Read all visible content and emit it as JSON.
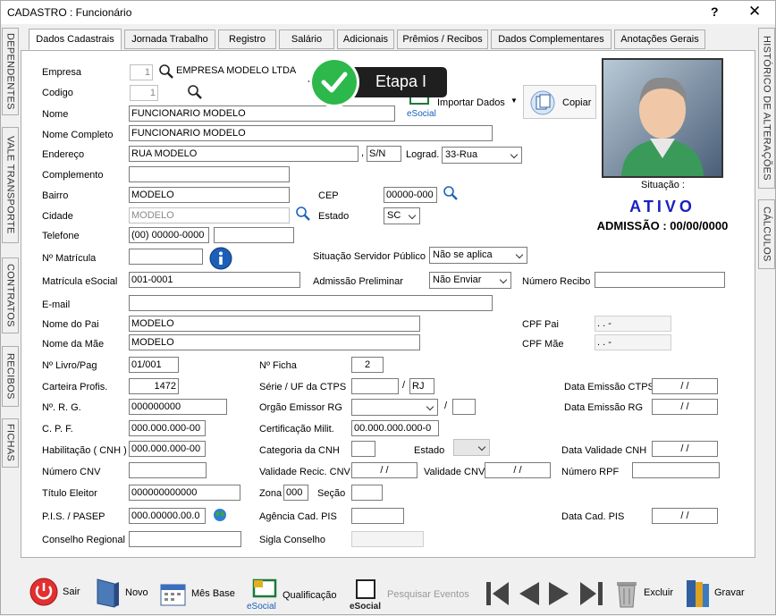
{
  "window": {
    "title": "CADASTRO : Funcionário",
    "help": "?",
    "close": "✕"
  },
  "side_tabs_left": [
    "DEPENDENTES",
    "VALE TRANSPORTE",
    "CONTRATOS",
    "RECIBOS",
    "FICHAS"
  ],
  "side_tabs_right": [
    "HISTÓRICO DE ALTERAÇÕES",
    "CÁLCULOS"
  ],
  "tabs": [
    "Dados Cadastrais",
    "Jornada Trabalho",
    "Registro",
    "Salário",
    "Adicionais",
    "Prêmios / Recibos",
    "Dados Complementares",
    "Anotações Gerais"
  ],
  "callout": {
    "label": "Etapa I"
  },
  "actions": {
    "importar": "Importar Dados",
    "esocial": "eSocial",
    "copiar": "Copiar"
  },
  "profile": {
    "situacao_label": "Situação :",
    "situacao": "ATIVO",
    "admissao": "ADMISSÃO : 00/00/0000"
  },
  "form": {
    "empresa_label": "Empresa",
    "empresa_code": "1",
    "empresa_name": "EMPRESA MODELO LTDA",
    "codigo_label": "Codigo",
    "codigo": "1",
    "nome_label": "Nome",
    "nome": "FUNCIONARIO MODELO",
    "nome_completo_label": "Nome Completo",
    "nome_completo": "FUNCIONARIO MODELO",
    "endereco_label": "Endereço",
    "endereco": "RUA MODELO",
    "numero": "S/N",
    "lograd_label": "Lograd.",
    "lograd": "33-Rua",
    "complemento_label": "Complemento",
    "complemento": "",
    "bairro_label": "Bairro",
    "bairro": "MODELO",
    "cep_label": "CEP",
    "cep": "00000-000",
    "cidade_label": "Cidade",
    "cidade": "MODELO",
    "estado_label": "Estado",
    "estado": "SC",
    "telefone_label": "Telefone",
    "telefone": "(00) 00000-0000",
    "telefone2": "",
    "matricula_label": "Nº  Matrícula",
    "matricula": "",
    "sit_servidor_label": "Situação Servidor Público",
    "sit_servidor": "Não se aplica",
    "matricula_esocial_label": "Matrícula eSocial",
    "matricula_esocial": "001-0001",
    "admissao_prelim_label": "Admissão Preliminar",
    "admissao_prelim": "Não Enviar",
    "numero_recibo_label": "Número Recibo",
    "numero_recibo": "",
    "email_label": "E-mail",
    "email": "",
    "pai_label": "Nome do Pai",
    "pai": "MODELO",
    "cpf_pai_label": "CPF Pai",
    "cpf_pai": " .   .   -",
    "mae_label": "Nome da Mãe",
    "mae": "MODELO",
    "cpf_mae_label": "CPF Mãe",
    "cpf_mae": " .   .   -",
    "livro_label": "Nº Livro/Pag",
    "livro": "01/001",
    "ficha_label": "Nº Ficha",
    "ficha": "2",
    "ctps_label": "Carteira Profis.",
    "ctps": "1472",
    "serie_label": "Série / UF da CTPS",
    "serie": "",
    "serie_sep": "/",
    "uf_ctps": "RJ",
    "data_ctps_label": "Data Emissão CTPS",
    "data_ctps": "/  /",
    "rg_label": "Nº.   R. G.",
    "rg": "000000000",
    "orgao_label": "Orgão Emissor RG",
    "orgao": "",
    "orgao_sep": "/",
    "orgao_uf": "",
    "data_rg_label": "Data Emissão RG",
    "data_rg": "/  /",
    "cpf_label": "C.  P.  F.",
    "cpf": "000.000.000-00",
    "cert_label": "Certificação Milit.",
    "cert": "00.000.000.000-0",
    "hab_label": "Habilitação  ( CNH )",
    "hab": "000.000.000-00",
    "cat_cnh_label": "Categoria da CNH",
    "cat_cnh": "",
    "estado_cnh_label": "Estado",
    "estado_cnh": "",
    "val_cnh_label": "Data Validade CNH",
    "val_cnh": "/  /",
    "cnv_label": "Número CNV",
    "cnv": "",
    "val_rec_cnv_label": "Validade Recic. CNV",
    "val_rec_cnv": "/  /",
    "val_cnv_label": "Validade CNV",
    "val_cnv": "/  /",
    "rpf_label": "Número RPF",
    "rpf": "",
    "titulo_label": "Título Eleitor",
    "titulo": "000000000000",
    "zona_label": "Zona",
    "zona": "000",
    "secao_label": "Seção",
    "secao": "",
    "pis_label": "P.I.S.  / PASEP",
    "pis": "000.00000.00.0",
    "agencia_pis_label": "Agência Cad. PIS",
    "agencia_pis": "",
    "data_pis_label": "Data Cad. PIS",
    "data_pis": "/  /",
    "conselho_label": "Conselho Regional",
    "conselho": "",
    "sigla_label": "Sigla Conselho",
    "sigla": ""
  },
  "toolbar": {
    "sair": "Sair",
    "novo": "Novo",
    "mes_base": "Mês Base",
    "qualificacao": "Qualificação",
    "esocial": "eSocial",
    "pesquisar": "Pesquisar Eventos",
    "excluir": "Excluir",
    "gravar": "Gravar"
  },
  "colors": {
    "status": "#1a20c0",
    "callout": "#1f1f1f",
    "check": "#2db84b"
  }
}
